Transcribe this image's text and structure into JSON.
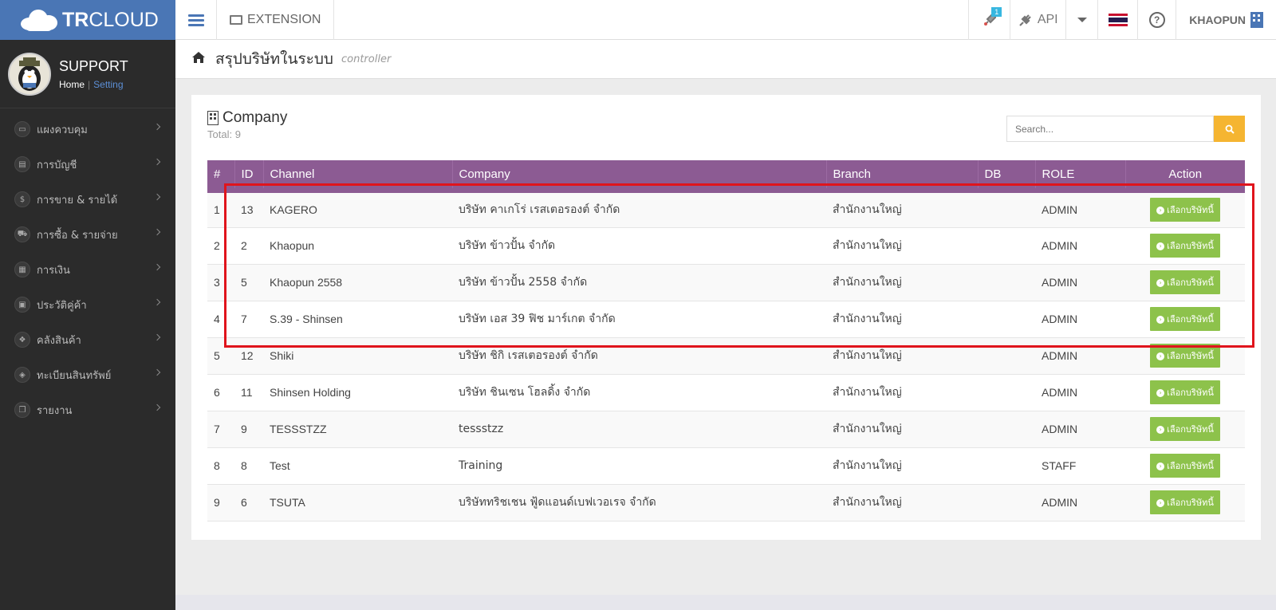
{
  "app": {
    "logo_bold": "TR",
    "logo_rest": "CLOUD",
    "extension_label": "EXTENSION",
    "notif_count": "1",
    "api_label": "API",
    "user_name": "KHAOPUN",
    "flag": "thailand-flag"
  },
  "profile": {
    "name": "SUPPORT",
    "home_link": "Home",
    "separator": "|",
    "setting_link": "Setting"
  },
  "menu": [
    {
      "label": "แผงควบคุม",
      "icon": "monitor-icon",
      "glyph": "▭"
    },
    {
      "label": "การบัญชี",
      "icon": "book-icon",
      "glyph": "▤"
    },
    {
      "label": "การขาย & รายได้",
      "icon": "dollar-icon",
      "glyph": "$"
    },
    {
      "label": "การซื้อ & รายจ่าย",
      "icon": "cart-icon",
      "glyph": "⛟"
    },
    {
      "label": "การเงิน",
      "icon": "calendar-icon",
      "glyph": "▦"
    },
    {
      "label": "ประวัติคู่ค้า",
      "icon": "contact-book-icon",
      "glyph": "▣"
    },
    {
      "label": "คลังสินค้า",
      "icon": "cubes-icon",
      "glyph": "❖"
    },
    {
      "label": "ทะเบียนสินทรัพย์",
      "icon": "diamond-icon",
      "glyph": "◈"
    },
    {
      "label": "รายงาน",
      "icon": "copy-icon",
      "glyph": "❐"
    }
  ],
  "page": {
    "title": "สรุปบริษัทในระบบ",
    "subtitle": "controller"
  },
  "panel": {
    "title": "Company",
    "total_label": "Total:",
    "total_value": "9",
    "search_placeholder": "Search..."
  },
  "table": {
    "columns": [
      "#",
      "ID",
      "Channel",
      "Company",
      "Branch",
      "DB",
      "ROLE",
      "Action"
    ],
    "action_label": "เลือกบริษัทนี้",
    "rows": [
      {
        "num": "1",
        "id": "13",
        "channel": "KAGERO",
        "company": "บริษัท คาเกโร่ เรสเตอรองต์ จำกัด",
        "branch": "สำนักงานใหญ่",
        "db": "",
        "role": "ADMIN"
      },
      {
        "num": "2",
        "id": "2",
        "channel": "Khaopun",
        "company": "บริษัท ข้าวปั้น จำกัด",
        "branch": "สำนักงานใหญ่",
        "db": "",
        "role": "ADMIN"
      },
      {
        "num": "3",
        "id": "5",
        "channel": "Khaopun 2558",
        "company": "บริษัท ข้าวปั้น 2558 จำกัด",
        "branch": "สำนักงานใหญ่",
        "db": "",
        "role": "ADMIN"
      },
      {
        "num": "4",
        "id": "7",
        "channel": "S.39 - Shinsen",
        "company": "บริษัท เอส 39 ฟิช มาร์เกต จำกัด",
        "branch": "สำนักงานใหญ่",
        "db": "",
        "role": "ADMIN"
      },
      {
        "num": "5",
        "id": "12",
        "channel": "Shiki",
        "company": "บริษัท ชิกิ เรสเตอรองต์ จำกัด",
        "branch": "สำนักงานใหญ่",
        "db": "",
        "role": "ADMIN"
      },
      {
        "num": "6",
        "id": "11",
        "channel": "Shinsen Holding",
        "company": "บริษัท ชินเซน โฮลดิ้ง จำกัด",
        "branch": "สำนักงานใหญ่",
        "db": "",
        "role": "ADMIN"
      },
      {
        "num": "7",
        "id": "9",
        "channel": "TESSSTZZ",
        "company": "tessstzz",
        "branch": "สำนักงานใหญ่",
        "db": "",
        "role": "ADMIN"
      },
      {
        "num": "8",
        "id": "8",
        "channel": "Test",
        "company": "Training",
        "branch": "สำนักงานใหญ่",
        "db": "",
        "role": "STAFF"
      },
      {
        "num": "9",
        "id": "6",
        "channel": "TSUTA",
        "company": "บริษัททริชเชน ฟู้ดแอนด์เบฟเวอเรจ จำกัด",
        "branch": "สำนักงานใหญ่",
        "db": "",
        "role": "ADMIN"
      }
    ]
  },
  "colors": {
    "brand": "#4a76b5",
    "table_header": "#8c5b93",
    "action_button": "#8dc24b",
    "search_button": "#f5b531",
    "highlight_box": "#e0141c"
  }
}
